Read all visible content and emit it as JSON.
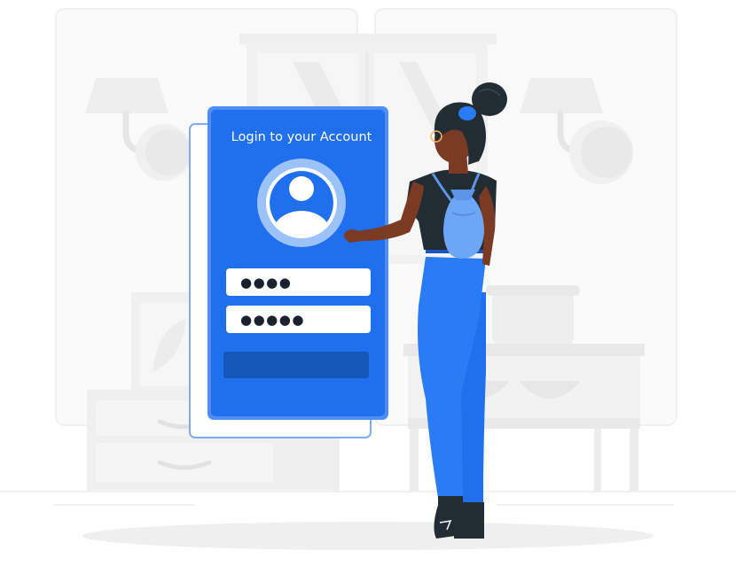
{
  "login_card": {
    "title": "Login to your Account",
    "password_field_1": "●●●●",
    "password_field_2": "●●●●●",
    "login_button_label": "",
    "avatar_icon": "user-avatar-icon"
  },
  "colors": {
    "primary_blue": "#1f6fee",
    "phone_border": "#4d8ff5",
    "button_blue": "#1457b8",
    "avatar_light": "#bdd6fb",
    "background_furniture": "#ececec",
    "skin": "#7a3a24",
    "hair_shirt": "#212c33"
  }
}
